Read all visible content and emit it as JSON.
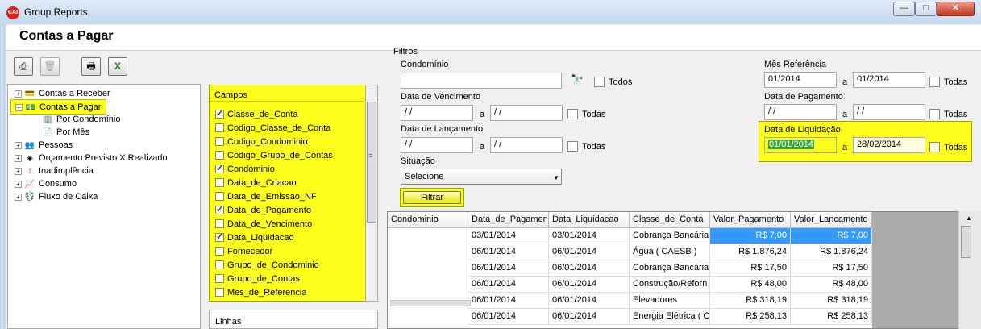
{
  "window": {
    "title": "Group Reports",
    "app_icon_text": "CAI",
    "minimize": "—",
    "maximize": "□",
    "close": "✕"
  },
  "header": {
    "title": "Contas a Pagar"
  },
  "toolbar": {
    "icons": [
      "run-report-icon",
      "delete-icon",
      "print-icon",
      "excel-icon"
    ]
  },
  "tree": {
    "items": [
      {
        "label": "Contas a Receber",
        "expander": "+",
        "icon": "receivable-icon"
      },
      {
        "label": "Contas a Pagar",
        "expander": "−",
        "icon": "payable-icon",
        "selected": true
      },
      {
        "label": "Por Condomínio",
        "icon": "building-icon"
      },
      {
        "label": "Por Mês",
        "icon": "document-icon"
      },
      {
        "label": "Pessoas",
        "expander": "+",
        "icon": "people-icon"
      },
      {
        "label": "Orçamento Previsto X Realizado",
        "expander": "+",
        "icon": "budget-icon"
      },
      {
        "label": "Inadimplência",
        "expander": "+",
        "icon": "alert-icon"
      },
      {
        "label": "Consumo",
        "expander": "+",
        "icon": "chart-icon"
      },
      {
        "label": "Fluxo de Caixa",
        "expander": "+",
        "icon": "cashflow-icon"
      }
    ]
  },
  "campos": {
    "header": "Campos",
    "items": [
      {
        "label": "Classe_de_Conta",
        "checked": true
      },
      {
        "label": "Codigo_Classe_de_Conta",
        "checked": false
      },
      {
        "label": "Codigo_Condominio",
        "checked": false
      },
      {
        "label": "Codigo_Grupo_de_Contas",
        "checked": false
      },
      {
        "label": "Condominio",
        "checked": true
      },
      {
        "label": "Data_de_Criacao",
        "checked": false
      },
      {
        "label": "Data_de_Emissao_NF",
        "checked": false
      },
      {
        "label": "Data_de_Pagamento",
        "checked": true
      },
      {
        "label": "Data_de_Vencimento",
        "checked": false
      },
      {
        "label": "Data_Liquidacao",
        "checked": true
      },
      {
        "label": "Fornecedor",
        "checked": false
      },
      {
        "label": "Grupo_de_Condominio",
        "checked": false
      },
      {
        "label": "Grupo_de_Contas",
        "checked": false
      },
      {
        "label": "Mes_de_Referencia",
        "checked": false
      }
    ]
  },
  "linhas": {
    "header": "Linhas"
  },
  "filtros": {
    "title": "Filtros",
    "condominio": {
      "label": "Condomínio",
      "value": "",
      "todas": "Todos"
    },
    "vencimento": {
      "label": "Data de Vencimento",
      "from": " / /",
      "a": "a",
      "to": " / /",
      "todas": "Todas"
    },
    "lancamento": {
      "label": "Data de Lançamento",
      "from": " / /",
      "a": "a",
      "to": " / /",
      "todas": "Todas"
    },
    "situacao": {
      "label": "Situação",
      "value": "Selecione"
    },
    "filtrar": "Filtrar",
    "mes_ref": {
      "label": "Mês Referência",
      "from": "01/2014",
      "a": "a",
      "to": "01/2014",
      "todas": "Todas"
    },
    "pagamento": {
      "label": "Data de Pagamento",
      "from": " / /",
      "a": "a",
      "to": " / /",
      "todas": "Todas"
    },
    "liquidacao": {
      "label": "Data de Liquidação",
      "from": "01/01/2014",
      "a": "a",
      "to": "28/02/2014",
      "todas": "Todas"
    }
  },
  "grid": {
    "columns": [
      "Condominio",
      "Data_de_Pagamen",
      "Data_Liquidacao",
      "Classe_de_Conta",
      "Valor_Pagamento",
      "Valor_Lancamento"
    ],
    "rows": [
      [
        "",
        "03/01/2014",
        "03/01/2014",
        "Cobrança Bancária",
        "R$ 7,00",
        "R$ 7,00"
      ],
      [
        "",
        "06/01/2014",
        "06/01/2014",
        "Água ( CAESB )",
        "R$ 1.876,24",
        "R$ 1.876,24"
      ],
      [
        "",
        "06/01/2014",
        "06/01/2014",
        "Cobrança Bancária",
        "R$ 17,50",
        "R$ 17,50"
      ],
      [
        "",
        "06/01/2014",
        "06/01/2014",
        "Construção/Reforn",
        "R$ 48,00",
        "R$ 48,00"
      ],
      [
        "",
        "06/01/2014",
        "06/01/2014",
        "Elevadores",
        "R$ 318,19",
        "R$ 318,19"
      ],
      [
        "",
        "06/01/2014",
        "06/01/2014",
        "Energia Elétrica ( C",
        "R$ 258,13",
        "R$ 258,13"
      ]
    ]
  }
}
